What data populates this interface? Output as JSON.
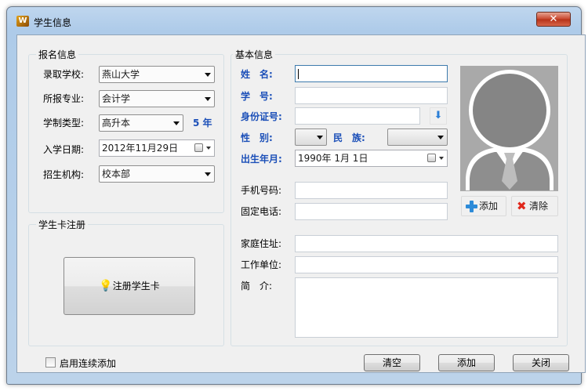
{
  "window": {
    "title": "学生信息",
    "close_glyph": "✕"
  },
  "enroll": {
    "group_label": "报名信息",
    "school_label": "录取学校:",
    "school_value": "燕山大学",
    "major_label": "所报专业:",
    "major_value": "会计学",
    "type_label": "学制类型:",
    "type_value": "高升本",
    "years_text": "5 年",
    "date_label": "入学日期:",
    "date_value": "2012年11月29日",
    "org_label": "招生机构:",
    "org_value": "校本部"
  },
  "card": {
    "group_label": "学生卡注册",
    "register_button": "注册学生卡"
  },
  "basic": {
    "group_label": "基本信息",
    "name_label": "姓　名:",
    "studentno_label": "学　号:",
    "idcard_label": "身份证号:",
    "gender_label": "性　别:",
    "ethnic_label": "民　族:",
    "birth_label": "出生年月:",
    "birth_value": "1990年  1月  1日",
    "mobile_label": "手机号码:",
    "phone_label": "固定电话:",
    "address_label": "家庭住址:",
    "work_label": "工作单位:",
    "intro_label": "简　介:"
  },
  "photo": {
    "add_button": "添加",
    "clear_button": "清除"
  },
  "footer": {
    "continuous_add_label": "启用连续添加",
    "continuous_add_checked": false,
    "clear_button": "清空",
    "add_button": "添加",
    "close_button": "关闭"
  },
  "colors": {
    "accent_label": "#1b4fb8",
    "add_icon": "#2d8bd8",
    "clear_icon": "#e0281c"
  }
}
